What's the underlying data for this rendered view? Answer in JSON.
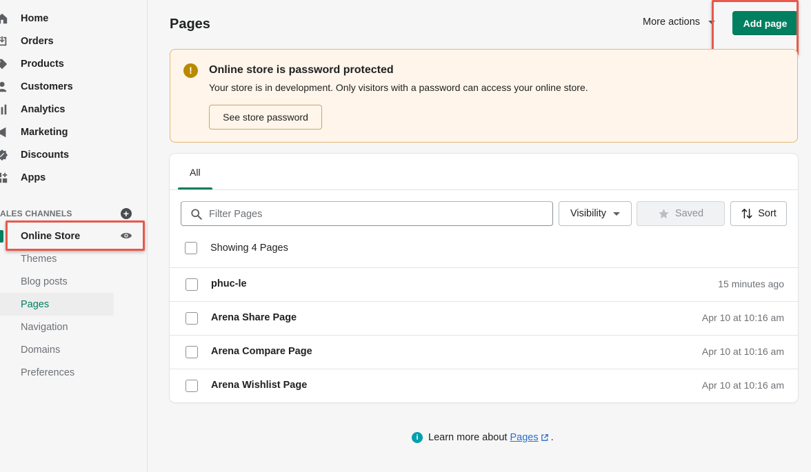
{
  "sidebar": {
    "nav": [
      {
        "label": "Home",
        "icon": "home-icon"
      },
      {
        "label": "Orders",
        "icon": "orders-icon"
      },
      {
        "label": "Products",
        "icon": "tag-icon"
      },
      {
        "label": "Customers",
        "icon": "person-icon"
      },
      {
        "label": "Analytics",
        "icon": "bar-chart-icon"
      },
      {
        "label": "Marketing",
        "icon": "megaphone-icon"
      },
      {
        "label": "Discounts",
        "icon": "discount-icon"
      },
      {
        "label": "Apps",
        "icon": "apps-icon"
      }
    ],
    "channels_header": "ALES CHANNELS",
    "online_store": "Online Store",
    "sub_items": [
      "Themes",
      "Blog posts",
      "Pages",
      "Navigation",
      "Domains",
      "Preferences"
    ],
    "active_sub": "Pages"
  },
  "header": {
    "title": "Pages",
    "more_actions": "More actions",
    "add_page": "Add page"
  },
  "banner": {
    "title": "Online store is password protected",
    "description": "Your store is in development. Only visitors with a password can access your online store.",
    "button": "See store password"
  },
  "list": {
    "tab": "All",
    "filter_placeholder": "Filter Pages",
    "visibility": "Visibility",
    "saved": "Saved",
    "sort": "Sort",
    "showing": "Showing 4 Pages",
    "rows": [
      {
        "name": "phuc-le",
        "time": "15 minutes ago"
      },
      {
        "name": "Arena Share Page",
        "time": "Apr 10 at 10:16 am"
      },
      {
        "name": "Arena Compare Page",
        "time": "Apr 10 at 10:16 am"
      },
      {
        "name": "Arena Wishlist Page",
        "time": "Apr 10 at 10:16 am"
      }
    ]
  },
  "footer": {
    "prefix": "Learn more about",
    "link": "Pages",
    "suffix": "."
  },
  "colors": {
    "primary": "#008060",
    "highlight": "#e8584b",
    "banner_bg": "#fff5ea",
    "link": "#2c6ecb"
  }
}
